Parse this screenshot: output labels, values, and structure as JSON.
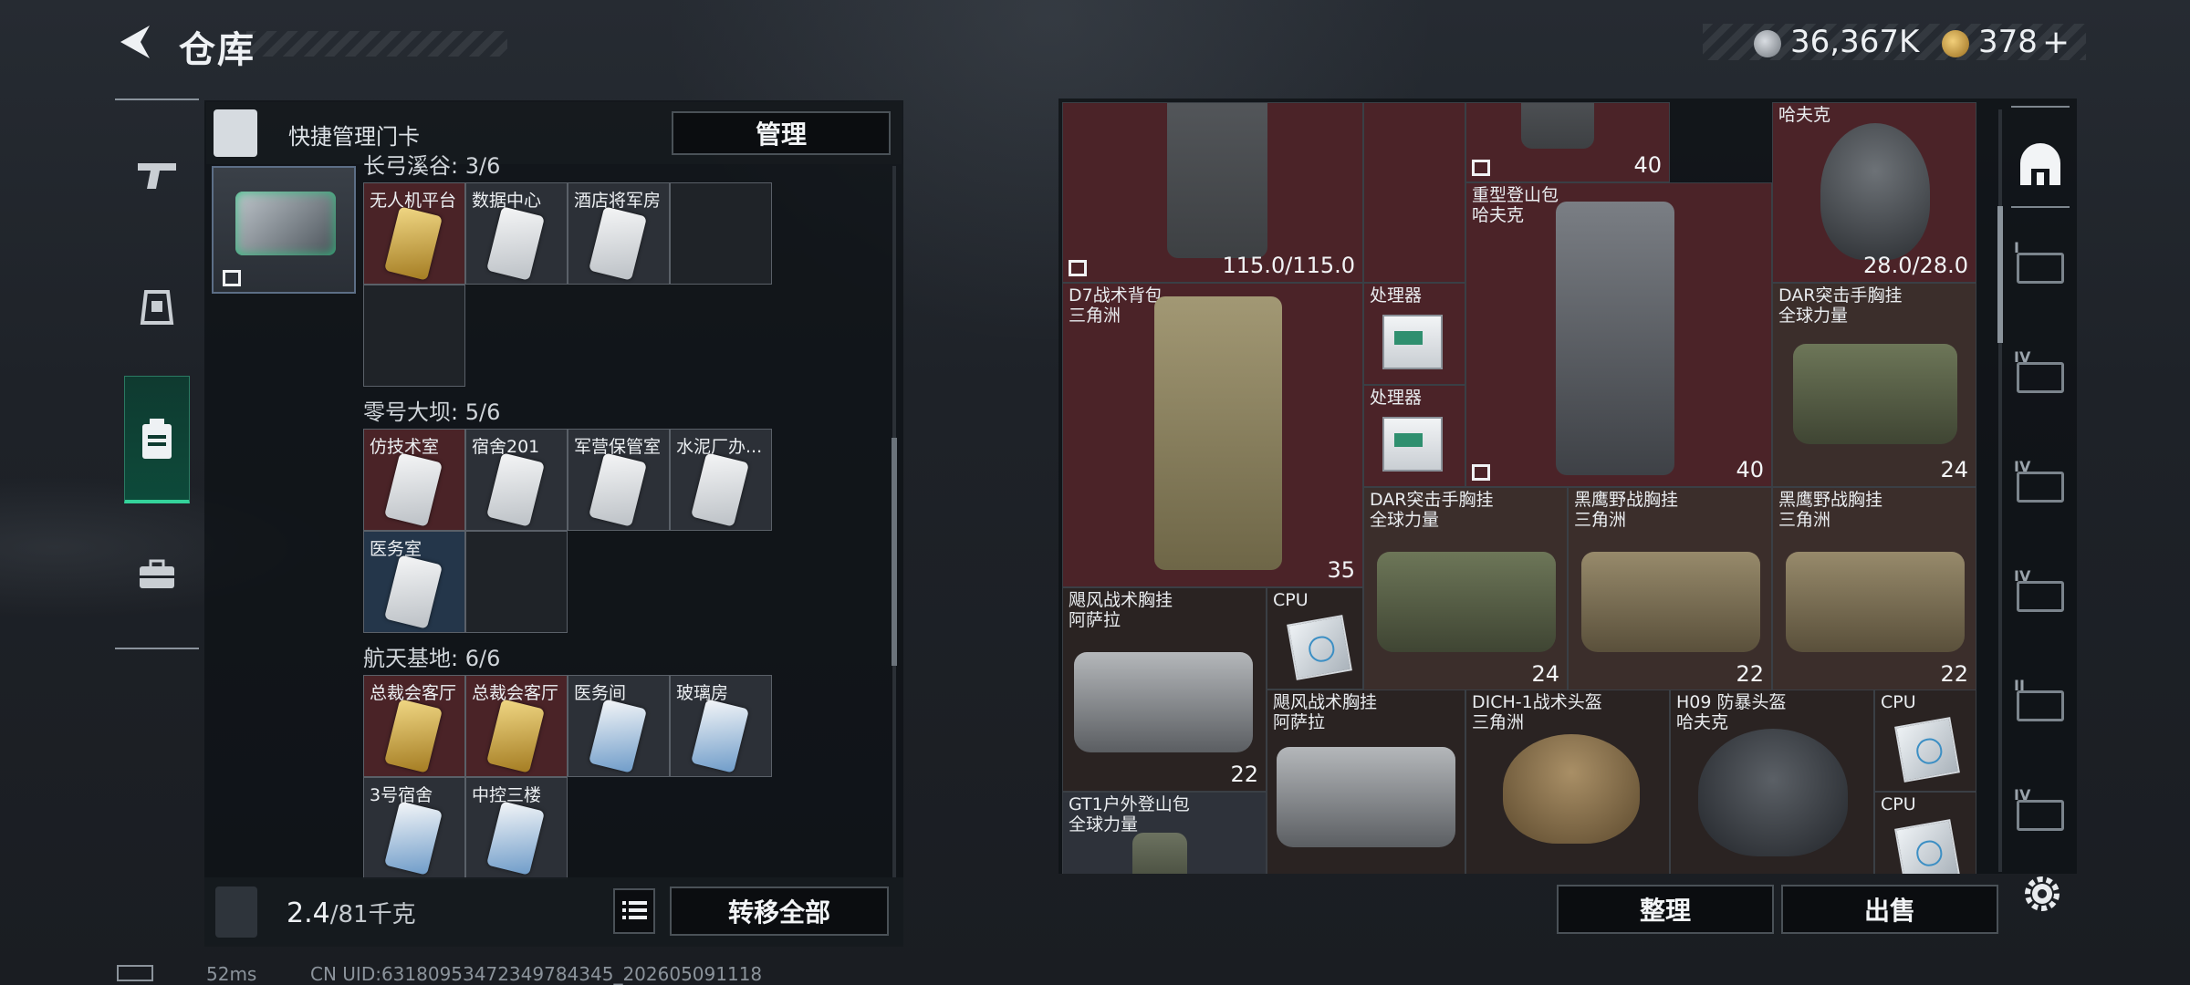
{
  "header": {
    "title": "仓库",
    "currency1": "36,367K",
    "currency2": "378",
    "plus": "+"
  },
  "left_tabs": [
    {
      "name": "weapons",
      "icon": "gun-icon"
    },
    {
      "name": "equipment",
      "icon": "armor-icon"
    },
    {
      "name": "keycards",
      "icon": "card-icon",
      "active": true
    },
    {
      "name": "toolbox",
      "icon": "toolbox-icon"
    }
  ],
  "key_panel": {
    "title": "快捷管理门卡",
    "manage_label": "管理",
    "sections": [
      {
        "title": "长弓溪谷: 3/6",
        "cards": [
          {
            "label": "无人机平台",
            "bg": "red",
            "card": "gold"
          },
          {
            "label": "数据中心",
            "bg": "gray",
            "card": "white"
          },
          {
            "label": "酒店将军房",
            "bg": "gray",
            "card": "white"
          }
        ]
      },
      {
        "title": "零号大坝: 5/6",
        "cards": [
          {
            "label": "仿技术室",
            "bg": "red",
            "card": "white"
          },
          {
            "label": "宿舍201",
            "bg": "gray",
            "card": "white"
          },
          {
            "label": "军营保管室",
            "bg": "gray",
            "card": "white"
          },
          {
            "label": "水泥厂办...",
            "bg": "gray",
            "card": "white"
          },
          {
            "label": "医务室",
            "bg": "blue",
            "card": "white"
          }
        ]
      },
      {
        "title": "航天基地: 6/6",
        "cards": [
          {
            "label": "总裁会客厅",
            "bg": "red",
            "card": "gold"
          },
          {
            "label": "总裁会客厅",
            "bg": "red",
            "card": "gold"
          },
          {
            "label": "医务间",
            "bg": "gray",
            "card": "blue"
          },
          {
            "label": "玻璃房",
            "bg": "gray",
            "card": "blue"
          },
          {
            "label": "3号宿舍",
            "bg": "gray",
            "card": "blue"
          },
          {
            "label": "中控三楼",
            "bg": "gray",
            "card": "blue"
          }
        ]
      }
    ],
    "weight_current": "2.4",
    "weight_max": "/81千克",
    "transfer_label": "转移全部"
  },
  "stash_items": {
    "row0": {
      "backpack_durability": "115.0/115.0",
      "top_qty": "40",
      "helmet_brand": "哈夫克",
      "helmet_durability": "28.0/28.0"
    },
    "heavy_pack": {
      "name": "重型登山包",
      "brand": "哈夫克",
      "qty": "40"
    },
    "d7_pack": {
      "name": "D7战术背包",
      "brand": "三角洲",
      "qty": "35"
    },
    "processor1": {
      "name": "处理器"
    },
    "processor2": {
      "name": "处理器"
    },
    "dar_vest_top": {
      "name": "DAR突击手胸挂",
      "brand": "全球力量",
      "qty": "24"
    },
    "dar_vest_mid": {
      "name": "DAR突击手胸挂",
      "brand": "全球力量",
      "qty": "24"
    },
    "blackhawk1": {
      "name": "黑鹰野战胸挂",
      "brand": "三角洲",
      "qty": "22"
    },
    "blackhawk2": {
      "name": "黑鹰野战胸挂",
      "brand": "三角洲",
      "qty": "22"
    },
    "cyclone1": {
      "name": "飓风战术胸挂",
      "brand": "阿萨拉",
      "qty": "22"
    },
    "cpu1": {
      "name": "CPU"
    },
    "cyclone2": {
      "name": "飓风战术胸挂",
      "brand": "阿萨拉"
    },
    "dich": {
      "name": "DICH-1战术头盔",
      "brand": "三角洲"
    },
    "h09": {
      "name": "H09 防暴头盔",
      "brand": "哈夫克"
    },
    "cpu2": {
      "name": "CPU"
    },
    "cpu3": {
      "name": "CPU"
    },
    "gt1": {
      "name": "GT1户外登山包",
      "brand": "全球力量"
    }
  },
  "right_tabs": [
    "home",
    "I",
    "IV",
    "IV",
    "IV",
    "II",
    "IV"
  ],
  "actions": {
    "tidy_label": "整理",
    "sell_label": "出售"
  },
  "status": {
    "ping": "52ms",
    "uid": "CN UID:6318095347234978434​5_202605091118"
  },
  "colors": {
    "accent_green": "#34d39b",
    "red_cell": "#4b2328",
    "brown_cell": "#3b2e2b"
  }
}
